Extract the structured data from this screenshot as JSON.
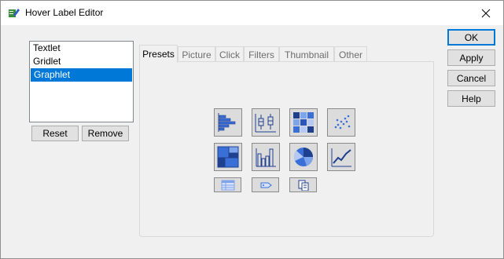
{
  "window": {
    "title": "Hover Label Editor"
  },
  "list": {
    "items": [
      {
        "label": "Textlet"
      },
      {
        "label": "Gridlet"
      },
      {
        "label": "Graphlet"
      }
    ],
    "selected": "Graphlet"
  },
  "list_buttons": {
    "reset": "Reset",
    "remove": "Remove"
  },
  "tabs": [
    {
      "label": "Presets"
    },
    {
      "label": "Picture"
    },
    {
      "label": "Click"
    },
    {
      "label": "Filters"
    },
    {
      "label": "Thumbnail"
    },
    {
      "label": "Other"
    }
  ],
  "active_tab": "Presets",
  "presets": {
    "large": [
      "bar-chart-icon",
      "box-plot-icon",
      "heatmap-icon",
      "scatter-plot-icon",
      "treemap-icon",
      "histogram-icon",
      "pie-chart-icon",
      "line-chart-icon"
    ],
    "small": [
      "table-icon",
      "label-tag-icon",
      "copy-paste-icon"
    ]
  },
  "dialog_buttons": {
    "ok": "OK",
    "apply": "Apply",
    "cancel": "Cancel",
    "help": "Help"
  },
  "colors": {
    "selection": "#0078d7",
    "icon_blue": "#3a6fd8",
    "icon_dark": "#1f3f8f"
  }
}
